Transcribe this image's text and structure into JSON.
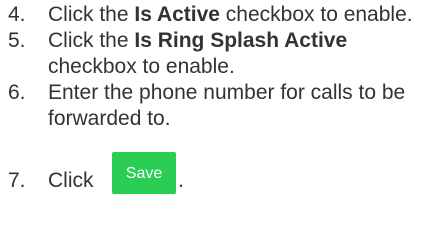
{
  "steps": [
    {
      "number": "4.",
      "pre": "Click the ",
      "bold": "Is Active",
      "post": " checkbox to enable."
    },
    {
      "number": "5.",
      "pre": "Click the ",
      "bold": "Is Ring Splash Active",
      "post": " checkbox to enable."
    },
    {
      "number": "6.",
      "pre": "Enter the phone number for calls to be forwarded to.",
      "bold": "",
      "post": ""
    }
  ],
  "last_step": {
    "number": "7.",
    "text": "Click",
    "button_label": "Save",
    "suffix": "."
  },
  "colors": {
    "text": "#333333",
    "save_button_bg": "#2bce55",
    "save_button_text": "#ffffff"
  }
}
